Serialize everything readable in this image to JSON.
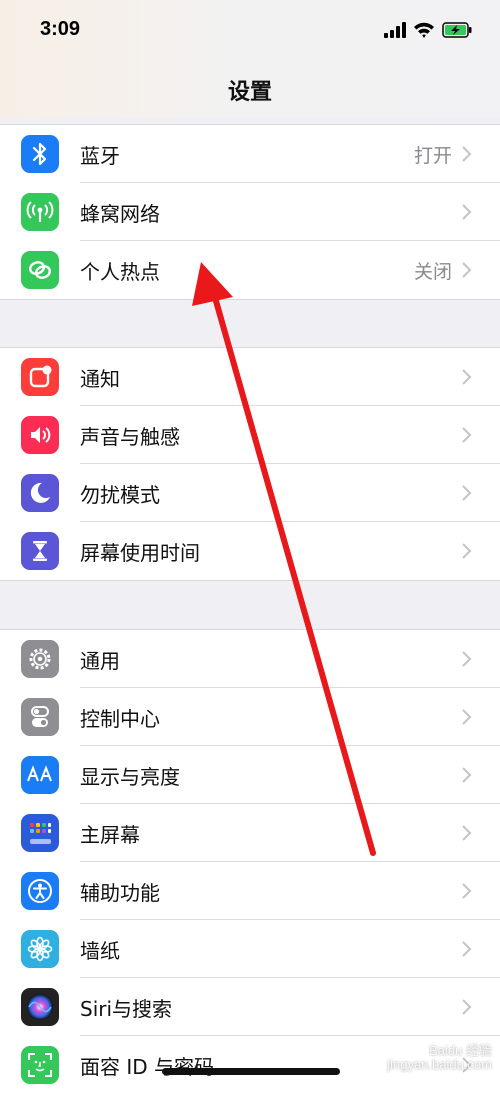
{
  "status": {
    "time": "3:09"
  },
  "nav": {
    "title": "设置"
  },
  "group1": [
    {
      "label": "蓝牙",
      "value": "打开",
      "icon": "bluetooth-icon",
      "color": "#1a7df5"
    },
    {
      "label": "蜂窝网络",
      "value": "",
      "icon": "cellular-antenna-icon",
      "color": "#34c759"
    },
    {
      "label": "个人热点",
      "value": "关闭",
      "icon": "hotspot-chain-icon",
      "color": "#34c759"
    }
  ],
  "group2": [
    {
      "label": "通知",
      "icon": "notifications-icon",
      "color": "#fc3d39"
    },
    {
      "label": "声音与触感",
      "icon": "speaker-icon",
      "color": "#fc2d55"
    },
    {
      "label": "勿扰模式",
      "icon": "moon-icon",
      "color": "#5b56d6"
    },
    {
      "label": "屏幕使用时间",
      "icon": "hourglass-icon",
      "color": "#5b56d6"
    }
  ],
  "group3": [
    {
      "label": "通用",
      "icon": "gear-icon",
      "color": "#8e8e93"
    },
    {
      "label": "控制中心",
      "icon": "toggles-icon",
      "color": "#8e8e93"
    },
    {
      "label": "显示与亮度",
      "icon": "text-size-icon",
      "color": "#1a7df5"
    },
    {
      "label": "主屏幕",
      "icon": "home-screen-grid-icon",
      "color": "#2b5bd8"
    },
    {
      "label": "辅助功能",
      "icon": "accessibility-icon",
      "color": "#1a7df5"
    },
    {
      "label": "墙纸",
      "icon": "flower-icon",
      "color": "#30b0e0"
    },
    {
      "label": "Siri与搜索",
      "icon": "siri-icon",
      "color": "#222"
    },
    {
      "label": "面容 ID 与密码",
      "icon": "face-id-icon",
      "color": "#34c759"
    }
  ],
  "watermark": "Baidu 经验\njingyan.baidu.com",
  "annotation": {
    "arrow_color": "#e8181b"
  }
}
